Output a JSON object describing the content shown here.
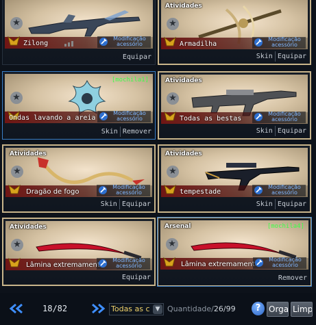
{
  "cards": [
    {
      "name": "Zilong",
      "tag": "",
      "bag": "",
      "modif": [
        "Modificação",
        "acessório"
      ],
      "actions": [
        "Equipar"
      ]
    },
    {
      "name": "Armadilha",
      "tag": "Atividades",
      "bag": "",
      "modif": [
        "Modificação",
        "acessório"
      ],
      "actions": [
        "Skin",
        "Equipar"
      ]
    },
    {
      "name": "Ondas lavando a areia",
      "tag": "",
      "bag": "[mochila1]",
      "modif": [
        "Modificação",
        "acessório"
      ],
      "actions": [
        "Skin",
        "Remover"
      ]
    },
    {
      "name": "Todas as bestas",
      "tag": "Atividades",
      "bag": "",
      "modif": [
        "Modificação",
        "acessório"
      ],
      "actions": [
        "Skin",
        "Equipar"
      ]
    },
    {
      "name": "Dragão de fogo",
      "tag": "Atividades",
      "bag": "",
      "modif": [
        "Modificação",
        "acessório"
      ],
      "actions": [
        "Skin",
        "Equipar"
      ]
    },
    {
      "name": "tempestade",
      "tag": "Atividades",
      "bag": "",
      "modif": [
        "Modificação",
        "acessório"
      ],
      "actions": [
        "Skin",
        "Equipar"
      ]
    },
    {
      "name": "Lâmina extremamente",
      "tag": "Atividades",
      "bag": "",
      "modif": [
        "Modificação",
        "acessório"
      ],
      "actions": [
        "Equipar"
      ]
    },
    {
      "name": "Lâmina extremamente",
      "tag": "Arsenal",
      "bag": "[mochila4]",
      "modif": [
        "Modificação",
        "acessório"
      ],
      "actions": [
        "Remover"
      ]
    }
  ],
  "pager": {
    "page": "18/82"
  },
  "filter": {
    "value": "Todas as c"
  },
  "quantity": {
    "label": "Quantidade/",
    "value": "26/99"
  },
  "buttons": {
    "help": "?",
    "organize": "Organizar",
    "clear": "Limpar"
  },
  "colors": {
    "accent": "#3a7fc8",
    "bag": "#3cff4a",
    "gold": "#c9b58b",
    "modif": "#7fb6ff"
  }
}
